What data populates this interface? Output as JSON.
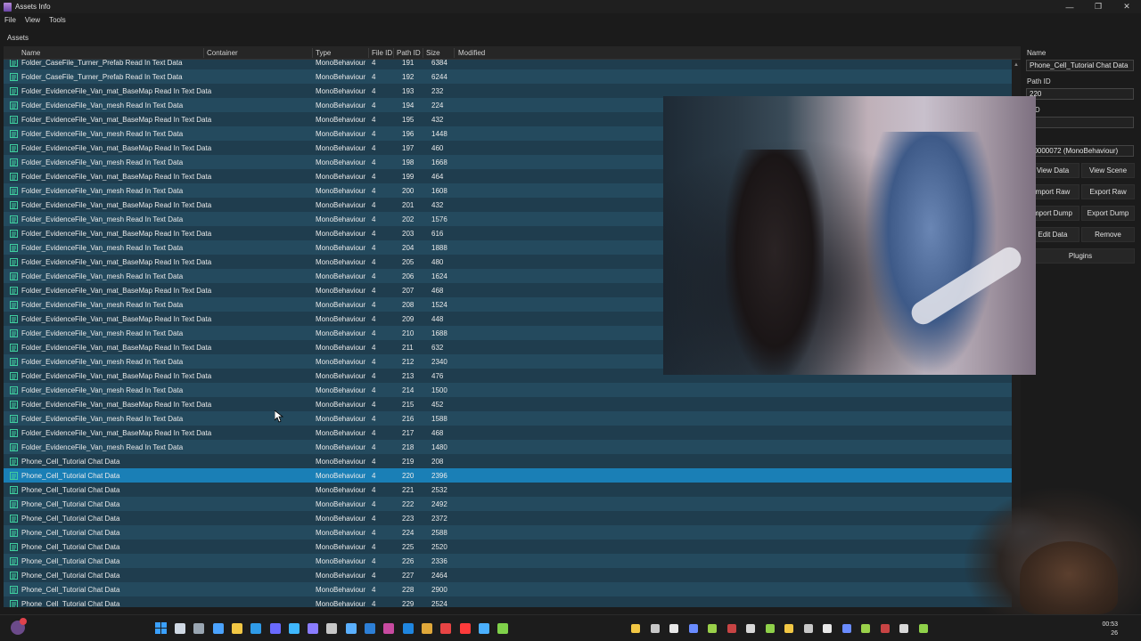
{
  "window": {
    "title": "Assets Info",
    "controls": [
      "—",
      "❐",
      "✕"
    ]
  },
  "menu": [
    "File",
    "View",
    "Tools"
  ],
  "assets_label": "Assets",
  "columns": [
    "Name",
    "Container",
    "Type",
    "File ID",
    "Path ID",
    "Size",
    "Modified"
  ],
  "rows": [
    {
      "name": "Folder_CaseFile_Turner_Prefab Read In Text Data",
      "type": "MonoBehaviour",
      "file_id": "4",
      "path_id": "191",
      "size": "6384"
    },
    {
      "name": "Folder_CaseFile_Turner_Prefab Read In Text Data",
      "type": "MonoBehaviour",
      "file_id": "4",
      "path_id": "192",
      "size": "6244"
    },
    {
      "name": "Folder_EvidenceFile_Van_mat_BaseMap Read In Text Data",
      "type": "MonoBehaviour",
      "file_id": "4",
      "path_id": "193",
      "size": "232"
    },
    {
      "name": "Folder_EvidenceFile_Van_mesh Read In Text Data",
      "type": "MonoBehaviour",
      "file_id": "4",
      "path_id": "194",
      "size": "224"
    },
    {
      "name": "Folder_EvidenceFile_Van_mat_BaseMap Read In Text Data",
      "type": "MonoBehaviour",
      "file_id": "4",
      "path_id": "195",
      "size": "432"
    },
    {
      "name": "Folder_EvidenceFile_Van_mesh Read In Text Data",
      "type": "MonoBehaviour",
      "file_id": "4",
      "path_id": "196",
      "size": "1448"
    },
    {
      "name": "Folder_EvidenceFile_Van_mat_BaseMap Read In Text Data",
      "type": "MonoBehaviour",
      "file_id": "4",
      "path_id": "197",
      "size": "460"
    },
    {
      "name": "Folder_EvidenceFile_Van_mesh Read In Text Data",
      "type": "MonoBehaviour",
      "file_id": "4",
      "path_id": "198",
      "size": "1668"
    },
    {
      "name": "Folder_EvidenceFile_Van_mat_BaseMap Read In Text Data",
      "type": "MonoBehaviour",
      "file_id": "4",
      "path_id": "199",
      "size": "464"
    },
    {
      "name": "Folder_EvidenceFile_Van_mesh Read In Text Data",
      "type": "MonoBehaviour",
      "file_id": "4",
      "path_id": "200",
      "size": "1608"
    },
    {
      "name": "Folder_EvidenceFile_Van_mat_BaseMap Read In Text Data",
      "type": "MonoBehaviour",
      "file_id": "4",
      "path_id": "201",
      "size": "432"
    },
    {
      "name": "Folder_EvidenceFile_Van_mesh Read In Text Data",
      "type": "MonoBehaviour",
      "file_id": "4",
      "path_id": "202",
      "size": "1576"
    },
    {
      "name": "Folder_EvidenceFile_Van_mat_BaseMap Read In Text Data",
      "type": "MonoBehaviour",
      "file_id": "4",
      "path_id": "203",
      "size": "616"
    },
    {
      "name": "Folder_EvidenceFile_Van_mesh Read In Text Data",
      "type": "MonoBehaviour",
      "file_id": "4",
      "path_id": "204",
      "size": "1888"
    },
    {
      "name": "Folder_EvidenceFile_Van_mat_BaseMap Read In Text Data",
      "type": "MonoBehaviour",
      "file_id": "4",
      "path_id": "205",
      "size": "480"
    },
    {
      "name": "Folder_EvidenceFile_Van_mesh Read In Text Data",
      "type": "MonoBehaviour",
      "file_id": "4",
      "path_id": "206",
      "size": "1624"
    },
    {
      "name": "Folder_EvidenceFile_Van_mat_BaseMap Read In Text Data",
      "type": "MonoBehaviour",
      "file_id": "4",
      "path_id": "207",
      "size": "468"
    },
    {
      "name": "Folder_EvidenceFile_Van_mesh Read In Text Data",
      "type": "MonoBehaviour",
      "file_id": "4",
      "path_id": "208",
      "size": "1524"
    },
    {
      "name": "Folder_EvidenceFile_Van_mat_BaseMap Read In Text Data",
      "type": "MonoBehaviour",
      "file_id": "4",
      "path_id": "209",
      "size": "448"
    },
    {
      "name": "Folder_EvidenceFile_Van_mesh Read In Text Data",
      "type": "MonoBehaviour",
      "file_id": "4",
      "path_id": "210",
      "size": "1688"
    },
    {
      "name": "Folder_EvidenceFile_Van_mat_BaseMap Read In Text Data",
      "type": "MonoBehaviour",
      "file_id": "4",
      "path_id": "211",
      "size": "632"
    },
    {
      "name": "Folder_EvidenceFile_Van_mesh Read In Text Data",
      "type": "MonoBehaviour",
      "file_id": "4",
      "path_id": "212",
      "size": "2340"
    },
    {
      "name": "Folder_EvidenceFile_Van_mat_BaseMap Read In Text Data",
      "type": "MonoBehaviour",
      "file_id": "4",
      "path_id": "213",
      "size": "476"
    },
    {
      "name": "Folder_EvidenceFile_Van_mesh Read In Text Data",
      "type": "MonoBehaviour",
      "file_id": "4",
      "path_id": "214",
      "size": "1500"
    },
    {
      "name": "Folder_EvidenceFile_Van_mat_BaseMap Read In Text Data",
      "type": "MonoBehaviour",
      "file_id": "4",
      "path_id": "215",
      "size": "452"
    },
    {
      "name": "Folder_EvidenceFile_Van_mesh Read In Text Data",
      "type": "MonoBehaviour",
      "file_id": "4",
      "path_id": "216",
      "size": "1588"
    },
    {
      "name": "Folder_EvidenceFile_Van_mat_BaseMap Read In Text Data",
      "type": "MonoBehaviour",
      "file_id": "4",
      "path_id": "217",
      "size": "468"
    },
    {
      "name": "Folder_EvidenceFile_Van_mesh Read In Text Data",
      "type": "MonoBehaviour",
      "file_id": "4",
      "path_id": "218",
      "size": "1480"
    },
    {
      "name": "Phone_Cell_Tutorial Chat Data",
      "type": "MonoBehaviour",
      "file_id": "4",
      "path_id": "219",
      "size": "208"
    },
    {
      "name": "Phone_Cell_Tutorial Chat Data",
      "type": "MonoBehaviour",
      "file_id": "4",
      "path_id": "220",
      "size": "2396",
      "selected": true
    },
    {
      "name": "Phone_Cell_Tutorial Chat Data",
      "type": "MonoBehaviour",
      "file_id": "4",
      "path_id": "221",
      "size": "2532"
    },
    {
      "name": "Phone_Cell_Tutorial Chat Data",
      "type": "MonoBehaviour",
      "file_id": "4",
      "path_id": "222",
      "size": "2492"
    },
    {
      "name": "Phone_Cell_Tutorial Chat Data",
      "type": "MonoBehaviour",
      "file_id": "4",
      "path_id": "223",
      "size": "2372"
    },
    {
      "name": "Phone_Cell_Tutorial Chat Data",
      "type": "MonoBehaviour",
      "file_id": "4",
      "path_id": "224",
      "size": "2588"
    },
    {
      "name": "Phone_Cell_Tutorial Chat Data",
      "type": "MonoBehaviour",
      "file_id": "4",
      "path_id": "225",
      "size": "2520"
    },
    {
      "name": "Phone_Cell_Tutorial Chat Data",
      "type": "MonoBehaviour",
      "file_id": "4",
      "path_id": "226",
      "size": "2336"
    },
    {
      "name": "Phone_Cell_Tutorial Chat Data",
      "type": "MonoBehaviour",
      "file_id": "4",
      "path_id": "227",
      "size": "2464"
    },
    {
      "name": "Phone_Cell_Tutorial Chat Data",
      "type": "MonoBehaviour",
      "file_id": "4",
      "path_id": "228",
      "size": "2900"
    },
    {
      "name": "Phone_Cell_Tutorial Chat Data",
      "type": "MonoBehaviour",
      "file_id": "4",
      "path_id": "229",
      "size": "2524"
    }
  ],
  "side_panel": {
    "name_label": "Name",
    "name_value": "Phone_Cell_Tutorial Chat Data",
    "path_id_label": "Path ID",
    "path_id_value": "220",
    "file_id_label": "e ID",
    "type_label": "pe",
    "type_value": "00000072 (MonoBehaviour)",
    "buttons": {
      "view_data": "View Data",
      "view_scene": "View Scene",
      "import_raw": "mport Raw",
      "export_raw": "Export Raw",
      "import_dump": "mport Dump",
      "export_dump": "Export Dump",
      "edit_data": "Edit Data",
      "remove": "Remove",
      "plugins": "Plugins"
    }
  },
  "colors": {
    "row_even": "#1f3d4e",
    "row_odd": "#244a5e",
    "row_selected": "#1a7fb6",
    "icon": "#3fcf9f"
  },
  "taskbar": {
    "icons": [
      "windows-start-icon",
      "search-icon",
      "task-view-icon",
      "widgets-icon",
      "file-explorer-icon",
      "edge-icon",
      "store-icon",
      "app-icon",
      "app-icon",
      "app-icon",
      "app-icon",
      "app-icon",
      "vscode-icon",
      "app-icon",
      "chrome-icon",
      "app-icon",
      "app-icon",
      "app-icon",
      "app-icon"
    ],
    "clock_time": "00:53",
    "clock_date": "26"
  }
}
